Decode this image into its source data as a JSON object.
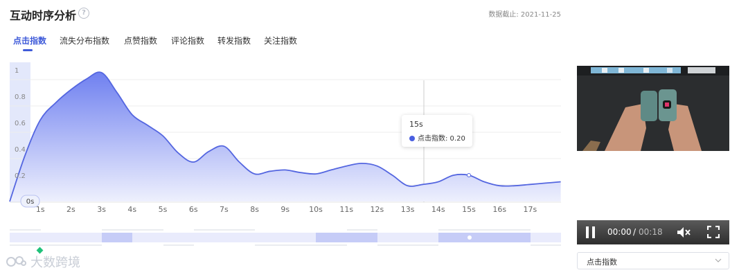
{
  "header": {
    "title": "互动时序分析",
    "help_glyph": "?",
    "data_as_of": "数据截止: 2021-11-25"
  },
  "tabs": [
    {
      "label": "点击指数",
      "active": true
    },
    {
      "label": "流失分布指数",
      "active": false
    },
    {
      "label": "点赞指数",
      "active": false
    },
    {
      "label": "评论指数",
      "active": false
    },
    {
      "label": "转发指数",
      "active": false
    },
    {
      "label": "关注指数",
      "active": false
    }
  ],
  "colors": {
    "accent": "#3f5bd9",
    "line": "#5466e0",
    "fill_top": "#7f8ef2",
    "fill_bottom": "#eef0fd",
    "marker": "#20c27a"
  },
  "chart_data": {
    "type": "area",
    "title": "",
    "xlabel": "",
    "ylabel": "",
    "x_ticks": [
      "1s",
      "2s",
      "3s",
      "4s",
      "5s",
      "6s",
      "7s",
      "8s",
      "9s",
      "10s",
      "11s",
      "12s",
      "13s",
      "14s",
      "15s",
      "16s",
      "17s"
    ],
    "y_ticks": [
      "0.2",
      "0.4",
      "0.6",
      "0.8",
      "1"
    ],
    "ylim": [
      0,
      1
    ],
    "grid": true,
    "current_time_label": "0s",
    "series": [
      {
        "x": [
          0,
          0.5,
          1,
          1.5,
          2,
          2.5,
          3,
          3.5,
          4,
          4.5,
          5,
          5.5,
          6,
          6.5,
          7,
          7.5,
          8,
          8.5,
          9,
          9.5,
          10,
          10.5,
          11,
          11.5,
          12,
          12.5,
          13,
          13.5,
          14,
          14.5,
          15,
          15.5,
          16,
          16.5,
          17,
          17.5,
          18
        ],
        "y": [
          0,
          0.35,
          0.62,
          0.75,
          0.85,
          0.93,
          0.98,
          0.83,
          0.66,
          0.58,
          0.5,
          0.37,
          0.3,
          0.38,
          0.42,
          0.3,
          0.21,
          0.23,
          0.24,
          0.22,
          0.21,
          0.24,
          0.27,
          0.29,
          0.27,
          0.2,
          0.12,
          0.13,
          0.15,
          0.2,
          0.2,
          0.15,
          0.12,
          0.12,
          0.13,
          0.14,
          0.15
        ]
      }
    ],
    "tooltip": {
      "x_label": "15s",
      "series_label": "点击指数: 0.20",
      "x": 15,
      "y": 0.2
    }
  },
  "video": {
    "current_time": "00:00",
    "separator": "/",
    "duration": "00:18"
  },
  "selector": {
    "value": "点击指数"
  },
  "watermark": {
    "text": "大数跨境"
  }
}
